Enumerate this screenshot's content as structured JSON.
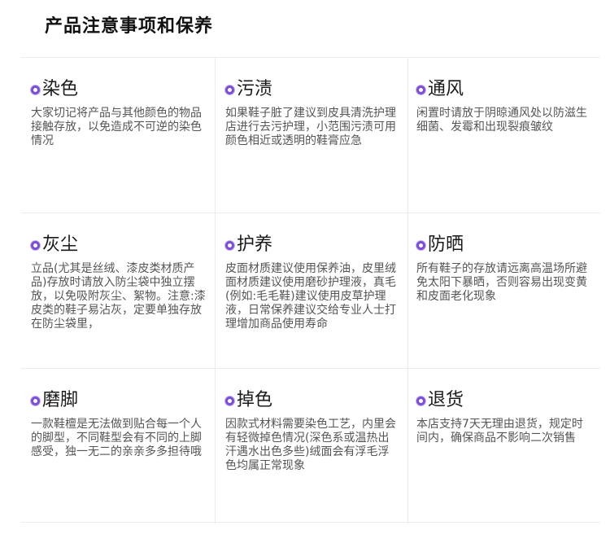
{
  "page_title": "产品注意事项和保养",
  "items": [
    {
      "title": "染色",
      "desc": "大家切记将产品与其他颜色的物品接触存放，以免造成不可逆的染色情况"
    },
    {
      "title": "污渍",
      "desc": "如果鞋子脏了建议到皮具清洗护理店进行去污护理，小范围污渍可用颜色相近或透明的鞋膏应急"
    },
    {
      "title": "通风",
      "desc": "闲置时请放于阴晾通风处以防滋生细菌、发霉和出现裂痕皱纹"
    },
    {
      "title": "灰尘",
      "desc": "立品(尤其是丝绒、漆皮类材质产品)存放时请放入防尘袋中独立摆放，以免吸附灰尘、絮物。注意:漆皮类的鞋子易沾灰，定要单独存放在防尘袋里，"
    },
    {
      "title": "护养",
      "desc": "皮面材质建议使用保养油，皮里绒面材质建议使用磨砂护理液，真毛(例如:毛毛鞋)建议使用皮草护理液，日常保养建议交给专业人士打理增加商品使用寿命"
    },
    {
      "title": "防晒",
      "desc": "所有鞋子的存放请远离高温场所避免太阳下暴晒，否则容易出现变黄和皮面老化现象"
    },
    {
      "title": "磨脚",
      "desc": "一款鞋檀是无法做到贴合每一个人的脚型，不同鞋型会有不同的上脚感受，独一无二的亲亲多多担待哦"
    },
    {
      "title": "掉色",
      "desc": "因款式材料需要染色工艺，内里会有轻微掉色情况(深色系或温热出汗遇水出色多些)绒面会有浮毛浮色均属正常现象"
    },
    {
      "title": "退货",
      "desc": "本店支持7天无理由退货，规定时间内，确保商品不影响二次销售"
    }
  ],
  "colors": {
    "accent": "#7d4fd2",
    "divider": "#ececec"
  },
  "icons": {
    "bullet": "purple-circle-bullet-icon"
  }
}
